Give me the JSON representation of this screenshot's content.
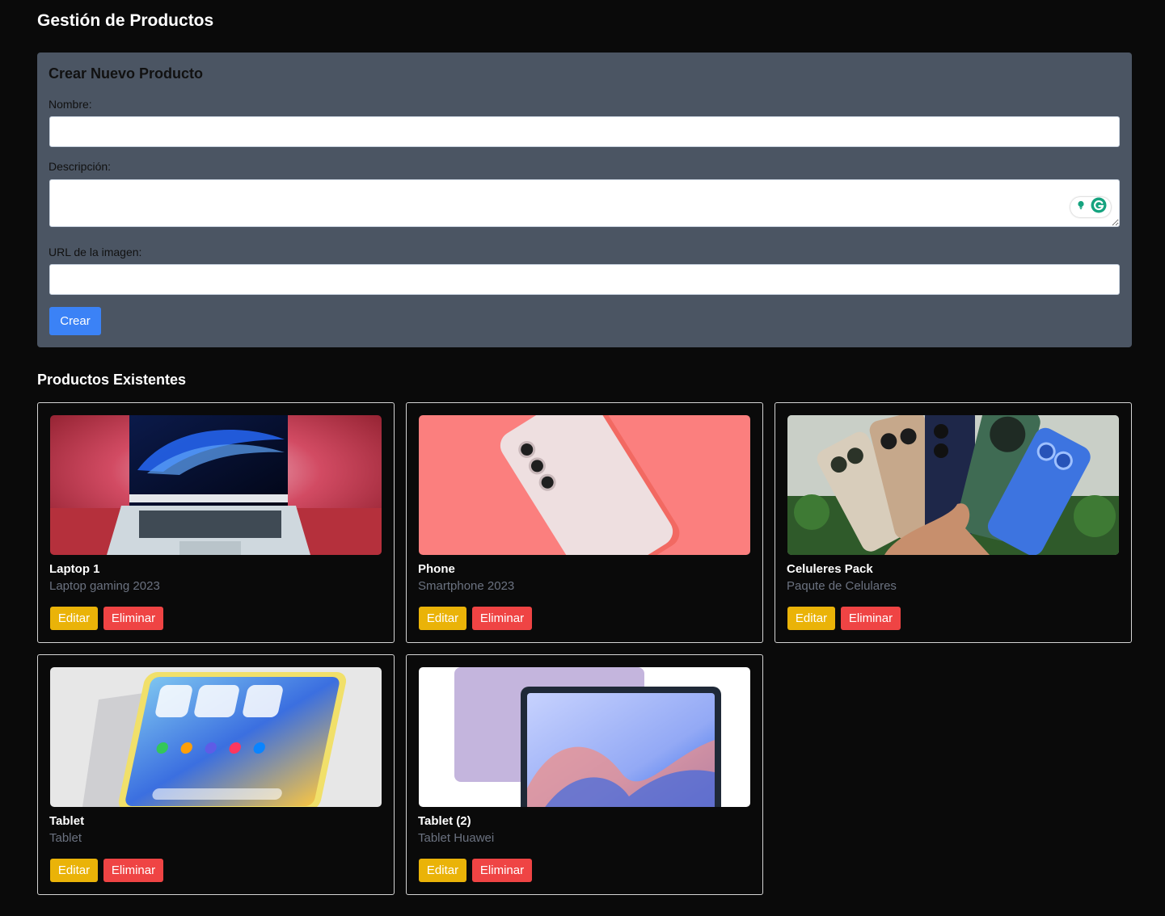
{
  "page": {
    "title": "Gestión de Productos"
  },
  "form": {
    "title": "Crear Nuevo Producto",
    "name_label": "Nombre:",
    "name_value": "",
    "description_label": "Descripción:",
    "description_value": "",
    "image_url_label": "URL de la imagen:",
    "image_url_value": "",
    "submit_label": "Crear"
  },
  "products_section": {
    "title": "Productos Existentes"
  },
  "products": [
    {
      "name": "Laptop 1",
      "description": "Laptop gaming 2023",
      "image": "laptop-photo",
      "edit_label": "Editar",
      "delete_label": "Eliminar"
    },
    {
      "name": "Phone",
      "description": "Smartphone 2023",
      "image": "phone-photo",
      "edit_label": "Editar",
      "delete_label": "Eliminar"
    },
    {
      "name": "Celuleres Pack",
      "description": "Paqute de Celulares",
      "image": "phones-pack-photo",
      "edit_label": "Editar",
      "delete_label": "Eliminar"
    },
    {
      "name": "Tablet",
      "description": "Tablet",
      "image": "tablet-photo",
      "edit_label": "Editar",
      "delete_label": "Eliminar"
    },
    {
      "name": "Tablet (2)",
      "description": "Tablet Huawei",
      "image": "tablet-huawei-photo",
      "edit_label": "Editar",
      "delete_label": "Eliminar"
    }
  ],
  "colors": {
    "background": "#0a0a0a",
    "panel": "#4b5563",
    "primary": "#3b82f6",
    "edit": "#eab308",
    "delete": "#ef4444",
    "muted_text": "#6b7280"
  },
  "icons": {
    "grammar_widget": [
      "lightbulb-icon",
      "grammarly-icon"
    ]
  }
}
